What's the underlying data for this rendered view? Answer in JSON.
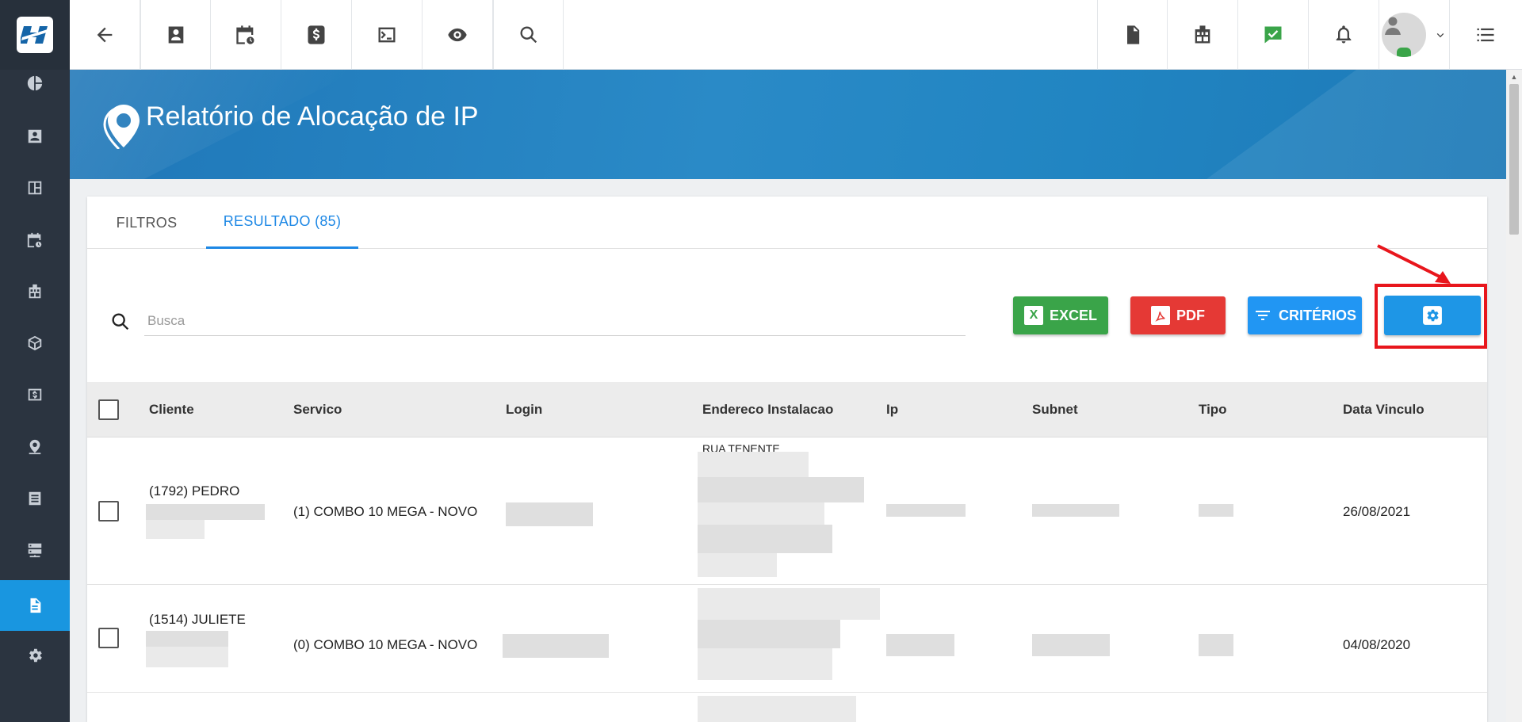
{
  "sidebar": {
    "logo_icon": "brand-logo-icon",
    "items": [
      {
        "icon": "pie-chart-icon"
      },
      {
        "icon": "contact-card-icon"
      },
      {
        "icon": "dashboard-icon"
      },
      {
        "icon": "calendar-clock-icon"
      },
      {
        "icon": "building-icon"
      },
      {
        "icon": "box-icon"
      },
      {
        "icon": "money-icon"
      },
      {
        "icon": "location-pin-icon"
      },
      {
        "icon": "list-icon"
      },
      {
        "icon": "server-icon"
      },
      {
        "icon": "document-icon",
        "active": true
      },
      {
        "icon": "gear-icon"
      }
    ]
  },
  "topbar": {
    "left_icons": [
      "back-arrow-icon",
      "contact-card-icon",
      "calendar-clock-icon",
      "dollar-icon",
      "terminal-icon",
      "eye-icon",
      "search-icon"
    ],
    "right_icons": [
      "pdf-icon",
      "building-icon",
      "chat-check-icon",
      "bell-icon",
      "avatar",
      "menu-icon"
    ]
  },
  "banner": {
    "title": "Relatório de Alocação de IP"
  },
  "tabs": [
    {
      "label": "FILTROS",
      "active": false
    },
    {
      "label": "RESULTADO (85)",
      "active": true
    }
  ],
  "search": {
    "placeholder": "Busca",
    "value": ""
  },
  "actions": {
    "excel_label": "EXCEL",
    "pdf_label": "PDF",
    "criterios_label": "CRITÉRIOS",
    "settings_icon": "gear-icon"
  },
  "colors": {
    "excel": "#3aa449",
    "pdf": "#e53935",
    "criterios": "#2196f3",
    "highlight": "#e8161c",
    "active_tab": "#1e88e5",
    "sidebar_bg": "#2b3440"
  },
  "table": {
    "columns": [
      "Cliente",
      "Servico",
      "Login",
      "Endereco Instalacao",
      "Ip",
      "Subnet",
      "Tipo",
      "Data Vinculo"
    ],
    "rows": [
      {
        "cliente": "(1792) PEDRO",
        "servico": "(1) COMBO 10 MEGA - NOVO",
        "endereco_partial": "RUA TENENTE",
        "data_vinculo": "26/08/2021"
      },
      {
        "cliente": "(1514) JULIETE",
        "servico": "(0) COMBO 10 MEGA - NOVO",
        "data_vinculo": "04/08/2020"
      }
    ]
  }
}
